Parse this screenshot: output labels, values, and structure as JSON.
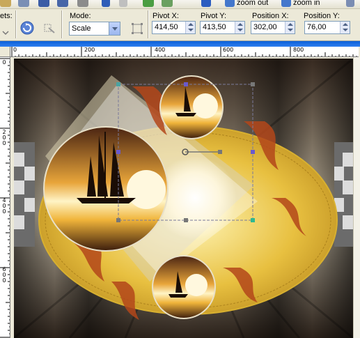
{
  "toolbar": {
    "presets_label": "ets:",
    "mode_label": "Mode:",
    "mode_value": "Scale",
    "pivot_x_label": "Pivot X:",
    "pivot_x_value": "414,50",
    "pivot_y_label": "Pivot Y:",
    "pivot_y_value": "413,50",
    "position_x_label": "Position X:",
    "position_x_value": "302,00",
    "position_y_label": "Position Y:",
    "position_y_value": "76,00"
  },
  "top_strip": {
    "zoom_out_label": "zoom out",
    "zoom_in_label": "zoom in"
  },
  "rulers": {
    "horizontal": [
      "0",
      "200",
      "400",
      "600",
      "800"
    ],
    "vertical": [
      "0",
      "2\n0\n0",
      "4\n0\n0",
      "6\n0\n0"
    ]
  },
  "colors": {
    "titlebar_blue": "#0a5fd8",
    "selection_handle": "#6a5acd",
    "canvas_gold": "#e8c040",
    "canvas_dark": "#2a1e16"
  },
  "icons": [
    "save-icon",
    "print-icon",
    "undo-icon",
    "redo-icon",
    "info-icon",
    "zoom-out-icon",
    "zoom-in-icon",
    "reset-icon",
    "flip-icon",
    "rectangle-icon"
  ]
}
